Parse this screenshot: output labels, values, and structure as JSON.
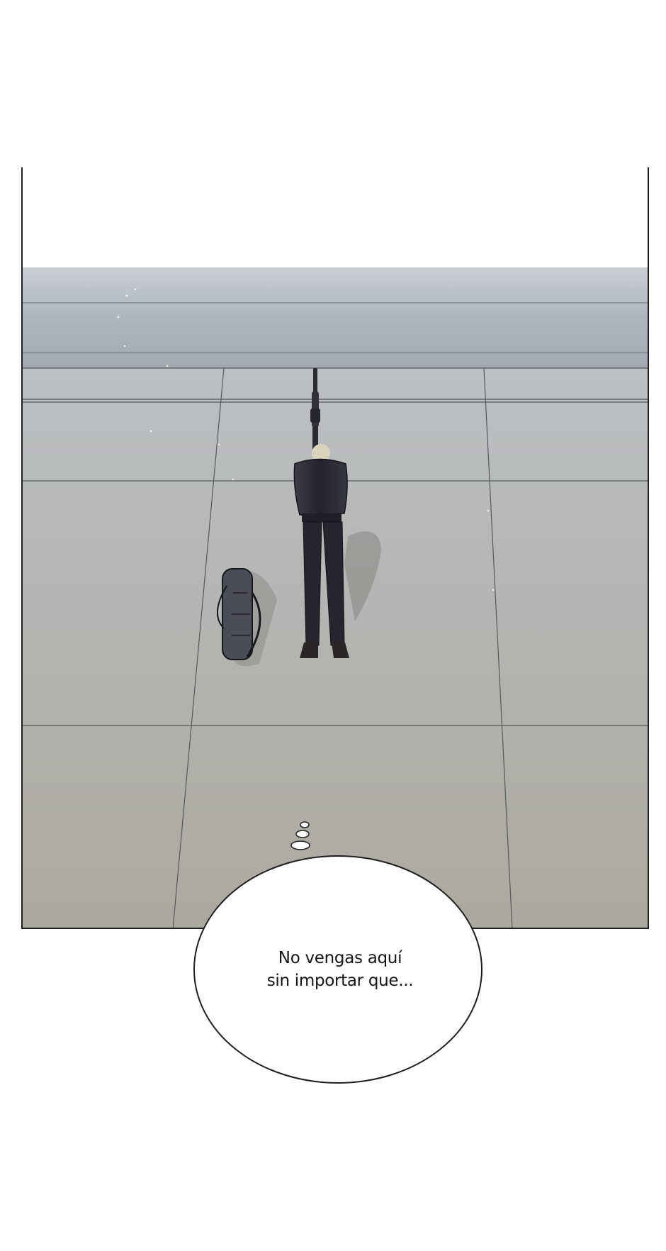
{
  "page": {
    "background": "#ffffff"
  },
  "panel": {
    "scene": "sniper-on-rooftop",
    "colors": {
      "sky": "#ffffff",
      "ledge": "#b8bec4",
      "floor": "#b6b6b0",
      "tile_line": "#55585a",
      "figure": "#2a2c34",
      "border": "#1e1e1e"
    }
  },
  "thought_bubble": {
    "text": "No vengas aquí\nsin importar que...",
    "fill": "#ffffff",
    "stroke": "#1e1e1e"
  }
}
